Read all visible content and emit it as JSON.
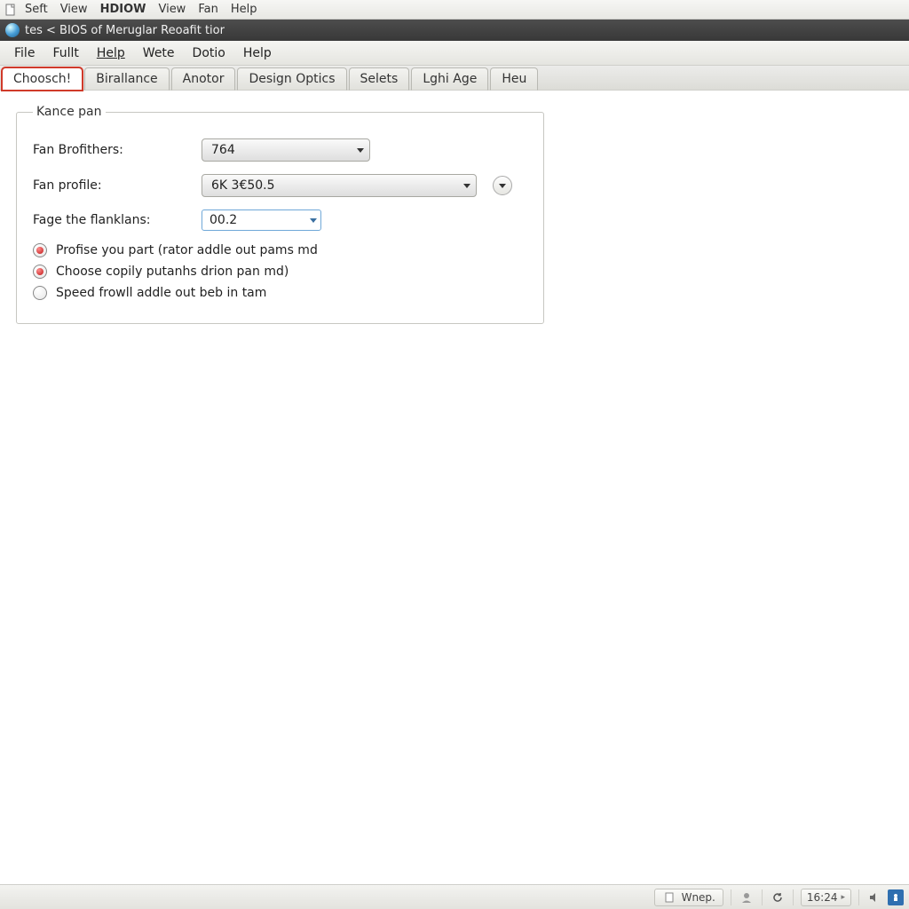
{
  "os_menubar": {
    "items": [
      "Seft",
      "View",
      "HDIOW",
      "View",
      "Fan",
      "Help"
    ],
    "bold_index": 2
  },
  "window": {
    "title": "tes < BIOS of Meruglar Reoafit tior"
  },
  "app_menubar": {
    "items": [
      "File",
      "Fullt",
      "Help",
      "Wete",
      "Dotio",
      "Help"
    ],
    "underlined_index": 2
  },
  "tabs": {
    "items": [
      "Choosch!",
      "Birallance",
      "Anotor",
      "Design Optics",
      "Selets",
      "Lghi Age",
      "Heu"
    ],
    "active_index": 0
  },
  "groupbox": {
    "legend": "Kance pan",
    "fields": {
      "brofithers_label": "Fan Brofithers:",
      "brofithers_value": "764",
      "profile_label": "Fan profile:",
      "profile_value": "6K 3€50.5",
      "flanklans_label": "Fage the flanklans:",
      "flanklans_value": "00.2"
    },
    "radios": [
      {
        "label": "Profise you part (rator addle out pams md",
        "checked": true
      },
      {
        "label": "Choose copily putanhs drion pan md)",
        "checked": true
      },
      {
        "label": "Speed frowll addle out beb in tam",
        "checked": false
      }
    ]
  },
  "taskbar": {
    "app_label": "Wnep.",
    "clock": "16:24"
  }
}
